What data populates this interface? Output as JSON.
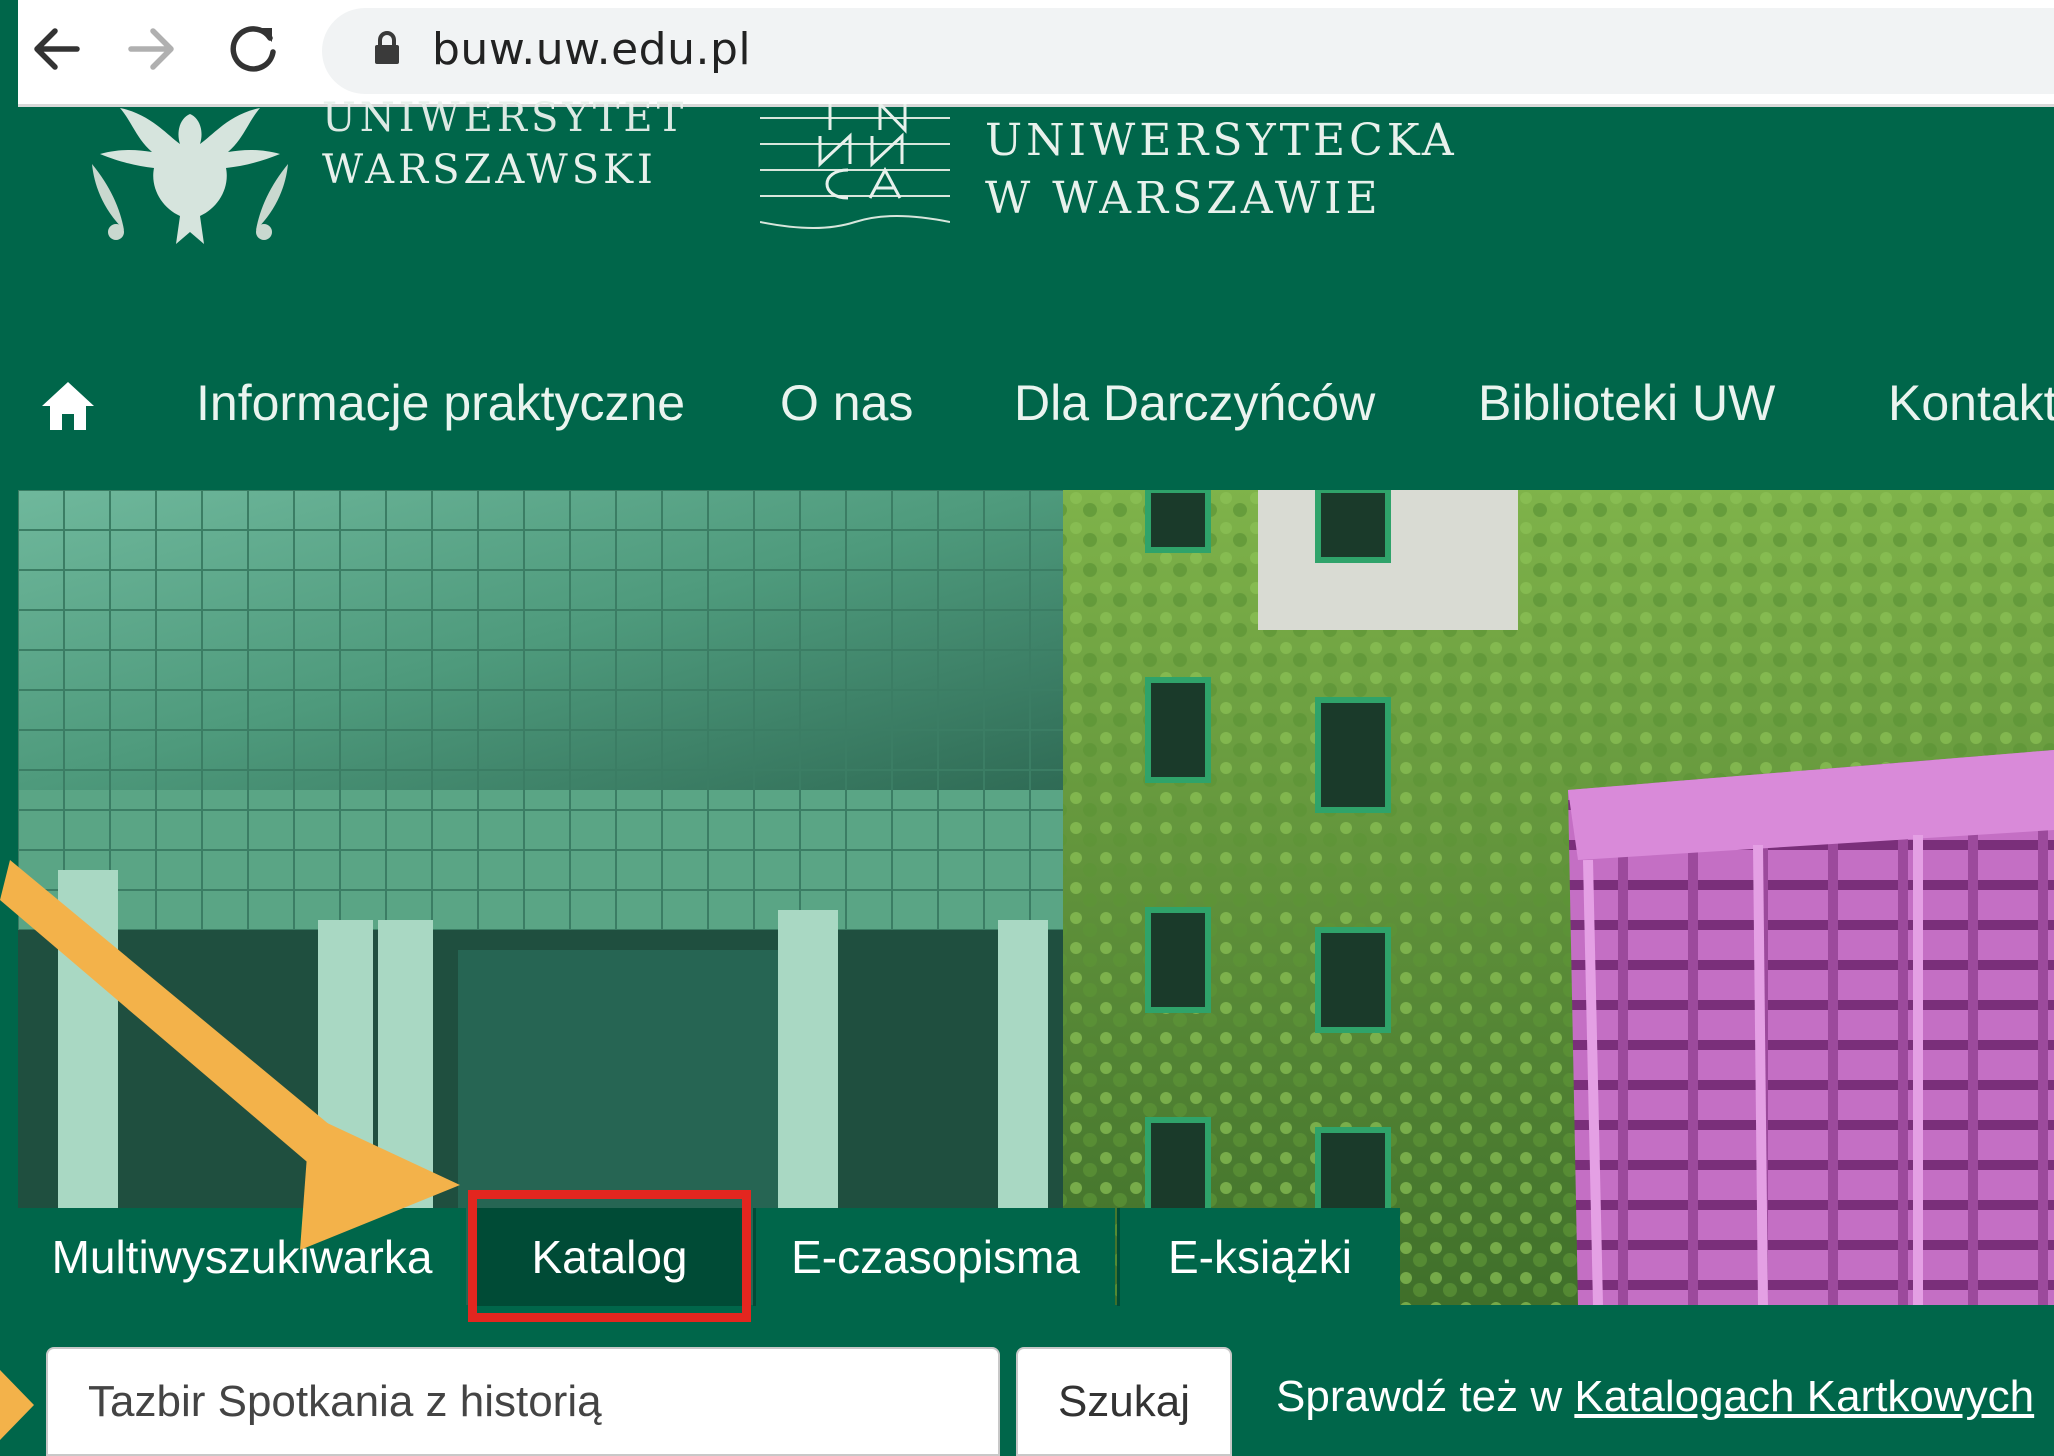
{
  "browser": {
    "url": "buw.uw.edu.pl"
  },
  "header": {
    "university_line1": "UNIWERSYTET",
    "university_line2": "WARSZAWSKI",
    "library_line1": "UNIWERSYTECKA",
    "library_line2": "W WARSZAWIE"
  },
  "nav": {
    "items": [
      {
        "label": "Informacje praktyczne"
      },
      {
        "label": "O nas"
      },
      {
        "label": "Dla Darczyńców"
      },
      {
        "label": "Biblioteki UW"
      },
      {
        "label": "Kontakt"
      }
    ]
  },
  "search": {
    "tabs": [
      {
        "label": "Multiwyszukiwarka"
      },
      {
        "label": "Katalog"
      },
      {
        "label": "E-czasopisma"
      },
      {
        "label": "E-książki"
      }
    ],
    "active_tab": "Katalog",
    "input_value": "Tazbir Spotkania z historią",
    "button_label": "Szukaj",
    "check_also_prefix": "Sprawdź też w ",
    "check_also_link": "Katalogach Kartkowych"
  },
  "colors": {
    "brand_green": "#00664a",
    "active_tab": "#004b36",
    "highlight": "#e3261f",
    "arrow": "#f3b24a"
  },
  "icons": {
    "back": "arrow-left-icon",
    "forward": "arrow-right-icon",
    "reload": "reload-icon",
    "lock": "lock-icon",
    "home": "home-icon"
  }
}
